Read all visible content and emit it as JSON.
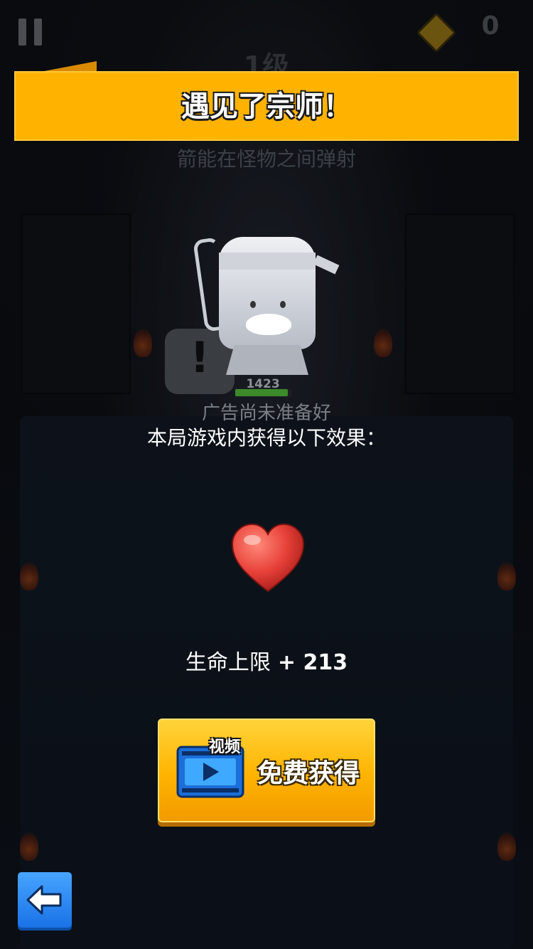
{
  "hud": {
    "coin_count": "0",
    "level": "1级",
    "pause_icon": "pause-icon",
    "gem_icon": "gem-icon"
  },
  "banner": {
    "title": "遇见了宗师！"
  },
  "skill_hint": "箭能在怪物之间弹射",
  "character": {
    "hp_value": "1423",
    "hp_fraction": 0.95,
    "speech_mark": "!"
  },
  "ad_status": "广告尚未准备好",
  "effect_intro": "本局游戏内获得以下效果：",
  "reward": {
    "icon": "heart-icon",
    "label": "生命上限",
    "value": "+ 213"
  },
  "free_button": {
    "tag": "视频",
    "label": "免费获得",
    "icon": "video-play-icon"
  },
  "back_button": {
    "icon": "back-arrow-icon"
  },
  "colors": {
    "banner": "#ffb300",
    "button": "#ffb300",
    "back_button": "#2a86f5",
    "heart": "#e8423a"
  }
}
